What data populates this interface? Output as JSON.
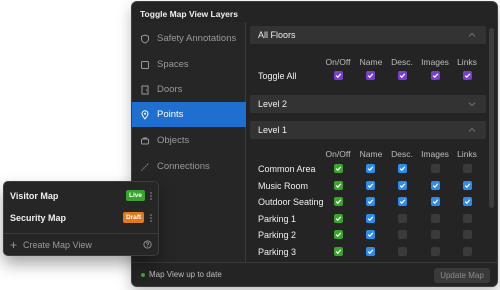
{
  "panel": {
    "title": "Toggle Map View Layers"
  },
  "sidebar": {
    "items": [
      {
        "label": "Safety Annotations",
        "icon": "shield-icon"
      },
      {
        "label": "Spaces",
        "icon": "square-icon"
      },
      {
        "label": "Doors",
        "icon": "door-icon"
      },
      {
        "label": "Points",
        "icon": "map-pin-icon"
      },
      {
        "label": "Objects",
        "icon": "box-icon"
      },
      {
        "label": "Connections",
        "icon": "connection-icon"
      }
    ],
    "active_index": 3
  },
  "columns": [
    "On/Off",
    "Name",
    "Desc.",
    "Images",
    "Links"
  ],
  "sections": {
    "all_floors": {
      "title": "All Floors",
      "toggle_all_label": "Toggle All",
      "toggle_all_states": [
        true,
        true,
        true,
        true,
        true
      ]
    },
    "level2": {
      "title": "Level 2"
    },
    "level1": {
      "title": "Level 1",
      "rows": [
        {
          "label": "Common Area",
          "states": [
            true,
            true,
            true,
            false,
            false
          ]
        },
        {
          "label": "Music Room",
          "states": [
            true,
            true,
            true,
            true,
            true
          ]
        },
        {
          "label": "Outdoor Seating",
          "states": [
            true,
            true,
            true,
            true,
            true
          ]
        },
        {
          "label": "Parking 1",
          "states": [
            true,
            true,
            false,
            false,
            false
          ]
        },
        {
          "label": "Parking 2",
          "states": [
            true,
            true,
            false,
            false,
            false
          ]
        },
        {
          "label": "Parking 3",
          "states": [
            true,
            true,
            false,
            false,
            false
          ]
        }
      ]
    }
  },
  "footer": {
    "status": "Map View up to date",
    "update_label": "Update Map"
  },
  "map_views": {
    "items": [
      {
        "name": "Visitor Map",
        "badge": "Live"
      },
      {
        "name": "Security Map",
        "badge": "Draft"
      }
    ],
    "create_label": "Create Map View"
  },
  "colors": {
    "accent": "#1f6fd1",
    "checkbox_green": "#3aa42e",
    "checkbox_blue": "#2d8cf0",
    "checkbox_purple": "#7a3ed8",
    "draft_badge": "#e07a1a"
  }
}
